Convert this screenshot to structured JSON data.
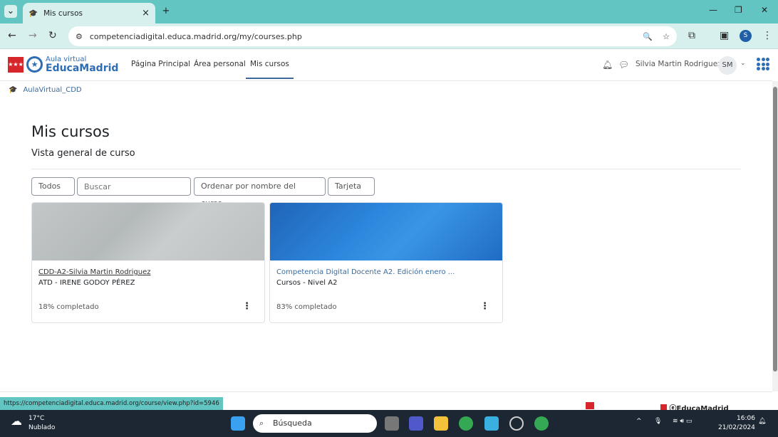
{
  "browser": {
    "tab_title": "Mis cursos",
    "url": "competenciadigital.educa.madrid.org/my/courses.php",
    "profile_initial": "S",
    "status_url": "https://competenciadigital.educa.madrid.org/course/view.php?id=5946"
  },
  "site": {
    "logo_small": "Aula virtual",
    "logo_big": "EducaMadrid",
    "nav": [
      "Página Principal",
      "Área personal",
      "Mis cursos"
    ],
    "user_name": "Silvia Martin Rodriguez",
    "user_initials": "SM"
  },
  "breadcrumb": "AulaVirtual_CDD",
  "page": {
    "title": "Mis cursos",
    "subtitle": "Vista general de curso"
  },
  "filters": {
    "grouping": "Todos",
    "search_placeholder": "Buscar",
    "sort": "Ordenar por nombre del curso",
    "view": "Tarjeta"
  },
  "courses": [
    {
      "name": "CDD-A2-Silvia Martin Rodriguez",
      "category": "ATD - IRENE GODOY PÉREZ",
      "progress_text": "18% completado",
      "progress": 18
    },
    {
      "name": "Competencia Digital Docente A2. Edición enero ...",
      "category": "Cursos - Nivel A2",
      "progress_text": "83% completado",
      "progress": 83
    }
  ],
  "taskbar": {
    "temp": "17°C",
    "weather": "Nublado",
    "search": "Búsqueda",
    "time": "16:06",
    "date": "21/02/2024"
  }
}
